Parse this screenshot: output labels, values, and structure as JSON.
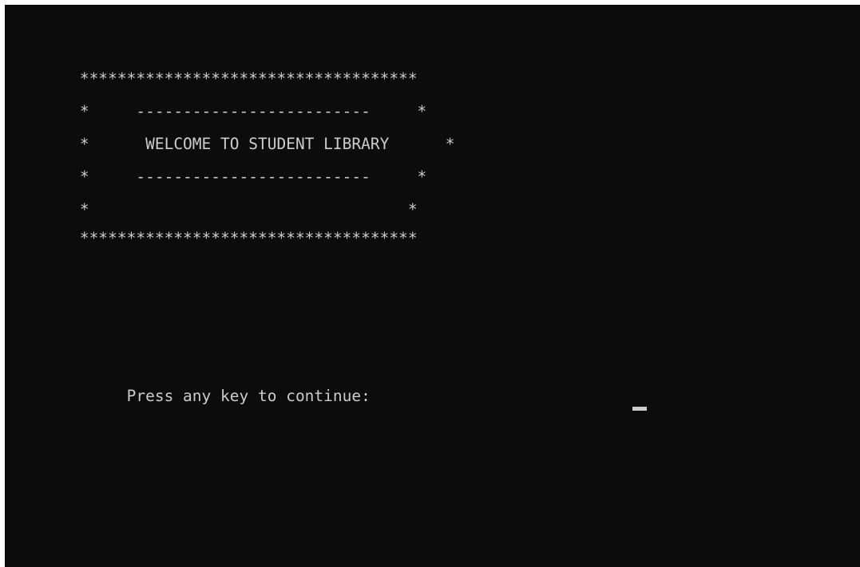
{
  "console": {
    "background_color": "#0c0c0c",
    "text_color": "#cccccc",
    "banner": {
      "rows": [
        "        ************************************",
        "        *     -------------------------     *",
        "        *      WELCOME TO STUDENT LIBRARY      *",
        "        *     -------------------------     *",
        "        *                                  *",
        "        ************************************"
      ]
    },
    "prompt": {
      "text": "             Press any key to continue: "
    }
  }
}
